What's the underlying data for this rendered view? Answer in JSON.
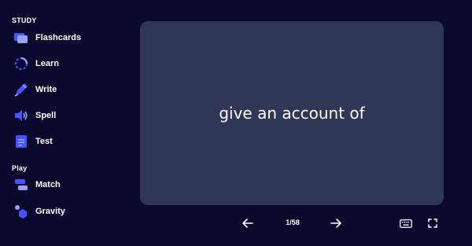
{
  "sidebar": {
    "study_heading": "STUDY",
    "play_heading": "Play",
    "study_items": [
      {
        "label": "Flashcards",
        "icon": "flashcards-icon"
      },
      {
        "label": "Learn",
        "icon": "learn-icon"
      },
      {
        "label": "Write",
        "icon": "write-icon"
      },
      {
        "label": "Spell",
        "icon": "spell-icon"
      },
      {
        "label": "Test",
        "icon": "test-icon"
      }
    ],
    "play_items": [
      {
        "label": "Match",
        "icon": "match-icon"
      },
      {
        "label": "Gravity",
        "icon": "gravity-icon"
      }
    ]
  },
  "card": {
    "term": "give an account of"
  },
  "controls": {
    "counter": "1/58"
  },
  "colors": {
    "background": "#0a092d",
    "card": "#2e3856",
    "icon_accent": "#4255ff",
    "icon_light": "#98a1ff"
  }
}
